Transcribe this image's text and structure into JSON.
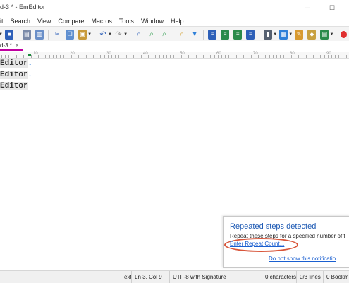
{
  "window": {
    "title": "d-3 * - EmEditor"
  },
  "menubar": {
    "items": [
      "it",
      "Search",
      "View",
      "Compare",
      "Macros",
      "Tools",
      "Window",
      "Help"
    ]
  },
  "tab": {
    "label": "d-3 *",
    "close_glyph": "×"
  },
  "ruler": {
    "labels": [
      "10",
      "20",
      "30",
      "40",
      "50",
      "60",
      "70",
      "80",
      "90"
    ]
  },
  "editor": {
    "lines": [
      "Editor",
      "Editor",
      "Editor"
    ],
    "eol_glyph": "↓"
  },
  "notification": {
    "title": "Repeated steps detected",
    "body": "Repeat these steps for a specified number of t",
    "link": "Enter Repeat Count...",
    "dismiss": "Do not show this notificatio"
  },
  "statusbar": {
    "mode": "Text",
    "position": "Ln 3, Col 9",
    "encoding": "UTF-8 with Signature",
    "characters": "0 characters",
    "lines": "0/3 lines",
    "bookmarks": "0 Bookm"
  },
  "colors": {
    "accent": "#c000a0",
    "link": "#1a5fd0",
    "notif_title": "#1e5ab4",
    "highlight_ring": "#d8553a",
    "eol": "#2e7bd6"
  }
}
